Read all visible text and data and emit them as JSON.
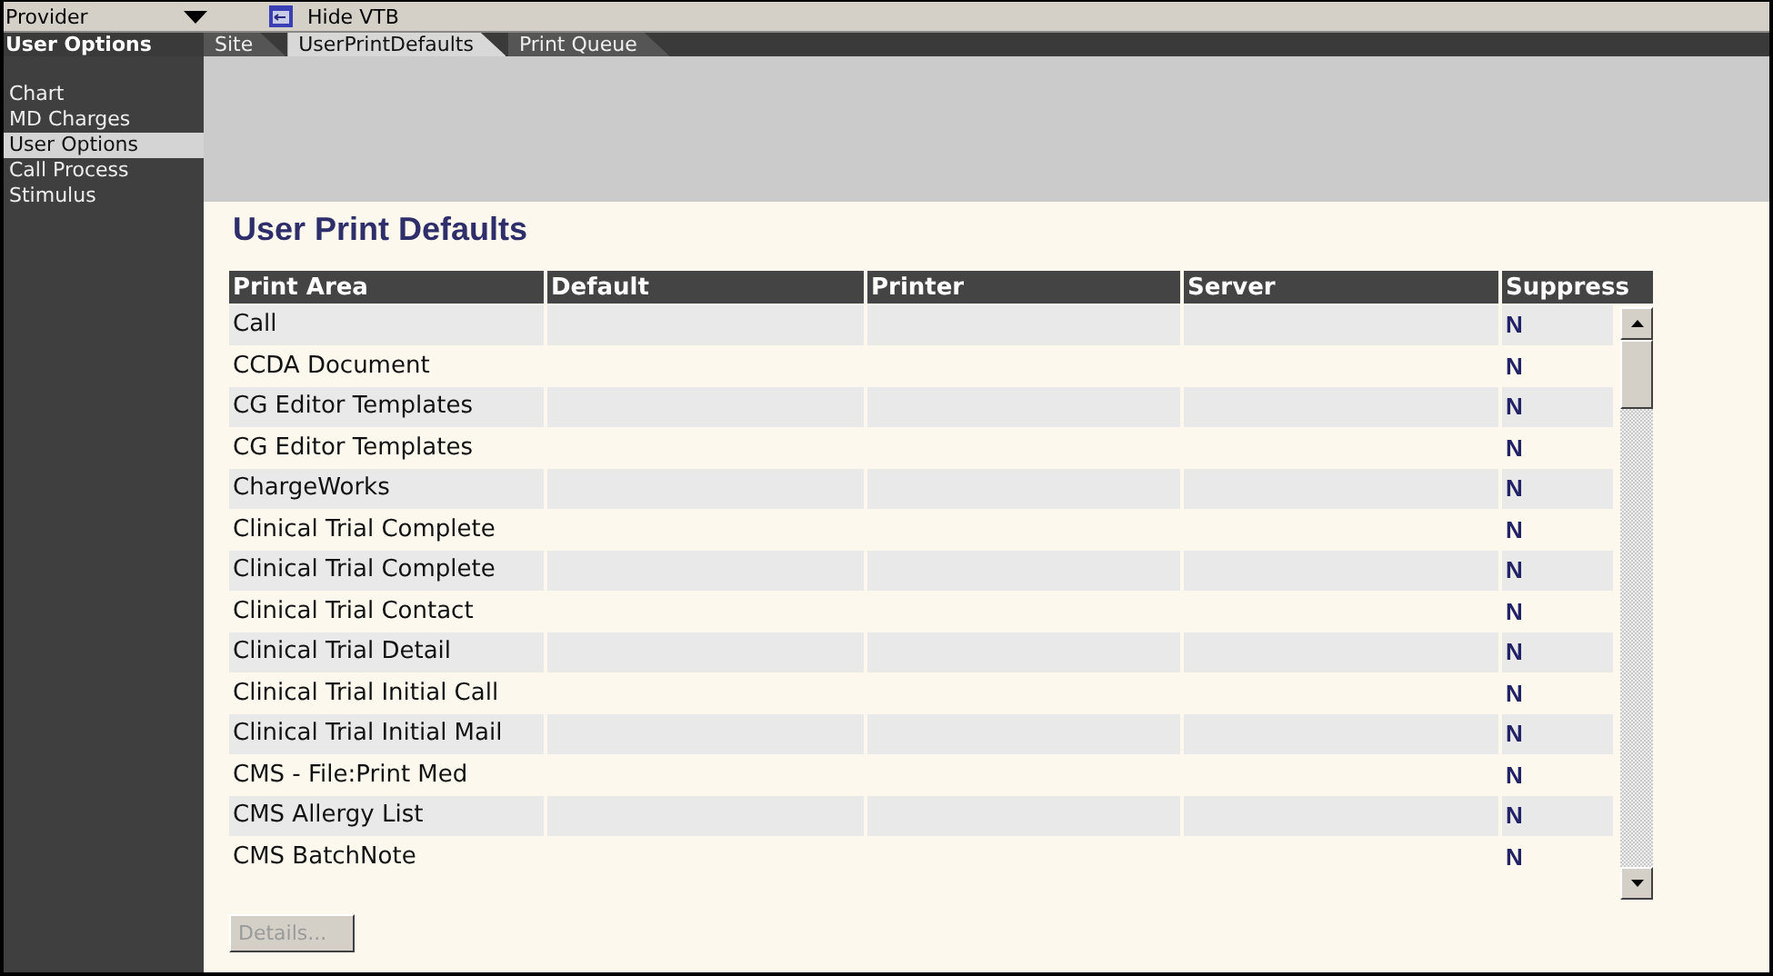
{
  "top_bar": {
    "provider_dropdown": {
      "value": "Provider"
    },
    "hide_button": {
      "label": "Hide VTB"
    }
  },
  "sidebar": {
    "title": "User Options",
    "items": [
      {
        "label": "Chart",
        "selected": false
      },
      {
        "label": "MD Charges",
        "selected": false
      },
      {
        "label": "User Options",
        "selected": true
      },
      {
        "label": "Call Process",
        "selected": false
      },
      {
        "label": "Stimulus",
        "selected": false
      }
    ]
  },
  "tabs": [
    {
      "label": "Site",
      "selected": false
    },
    {
      "label": "UserPrintDefaults",
      "selected": true
    },
    {
      "label": "Print Queue",
      "selected": false
    }
  ],
  "heading": "User Print Defaults",
  "table": {
    "columns": [
      "Print Area",
      "Default",
      "Printer",
      "Server",
      "Suppress"
    ],
    "rows": [
      {
        "print_area": "Call",
        "suppress": "N"
      },
      {
        "print_area": "CCDA Document",
        "suppress": "N"
      },
      {
        "print_area": "CG Editor Templates",
        "suppress": "N"
      },
      {
        "print_area": "CG Editor Templates",
        "suppress": "N"
      },
      {
        "print_area": "ChargeWorks",
        "suppress": "N"
      },
      {
        "print_area": "Clinical Trial Complete",
        "suppress": "N"
      },
      {
        "print_area": "Clinical Trial Complete",
        "suppress": "N"
      },
      {
        "print_area": "Clinical Trial Contact",
        "suppress": "N"
      },
      {
        "print_area": "Clinical Trial Detail",
        "suppress": "N"
      },
      {
        "print_area": "Clinical Trial Initial Call",
        "suppress": "N"
      },
      {
        "print_area": "Clinical Trial Initial Mail",
        "suppress": "N"
      },
      {
        "print_area": "CMS - File:Print Med",
        "suppress": "N"
      },
      {
        "print_area": "CMS Allergy List",
        "suppress": "N"
      },
      {
        "print_area": "CMS BatchNote",
        "suppress": "N"
      }
    ]
  },
  "details_button": {
    "label": "Details...",
    "disabled": true
  }
}
